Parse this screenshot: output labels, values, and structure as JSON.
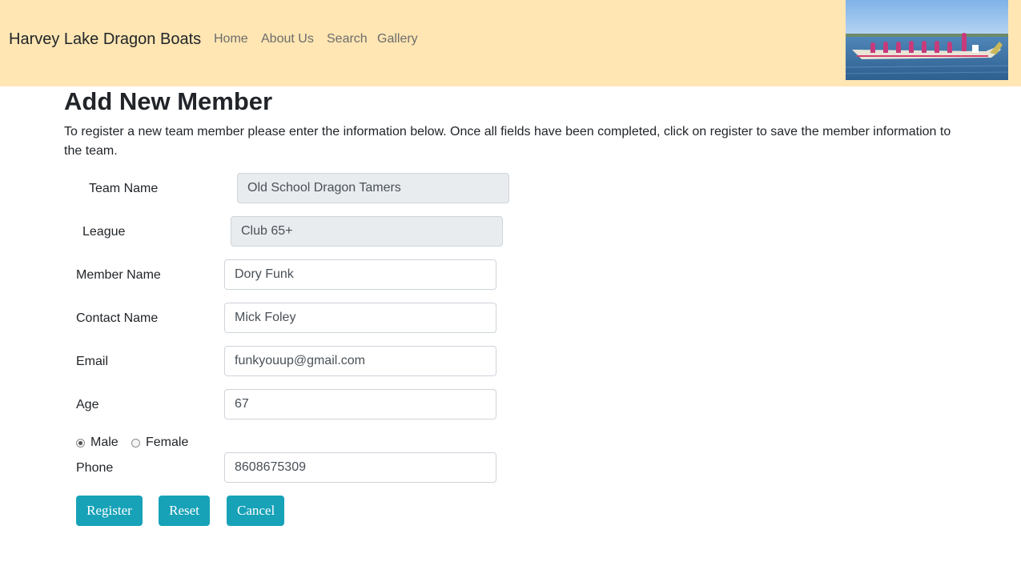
{
  "navbar": {
    "brand": "Harvey Lake Dragon Boats",
    "links": [
      "Home",
      "About Us",
      "Search",
      "Gallery"
    ],
    "bg_color": "#ffe6b3"
  },
  "page": {
    "title": "Add New Member",
    "intro": "To register a new team member please enter the information below. Once all fields have been completed, click on register to save the member information to the team."
  },
  "form": {
    "team_name": {
      "label": "Team Name",
      "value": "Old School Dragon Tamers"
    },
    "league": {
      "label": "League",
      "value": "Club 65+"
    },
    "member_name": {
      "label": "Member Name",
      "value": "Dory Funk"
    },
    "contact_name": {
      "label": "Contact Name",
      "value": "Mick Foley"
    },
    "email": {
      "label": "Email",
      "value": "funkyouup@gmail.com"
    },
    "age": {
      "label": "Age",
      "value": "67"
    },
    "gender": {
      "options": [
        "Male",
        "Female"
      ],
      "selected": "Male"
    },
    "phone": {
      "label": "Phone",
      "value": "8608675309"
    }
  },
  "buttons": {
    "register": "Register",
    "reset": "Reset",
    "cancel": "Cancel",
    "color": "#17a2b8"
  }
}
